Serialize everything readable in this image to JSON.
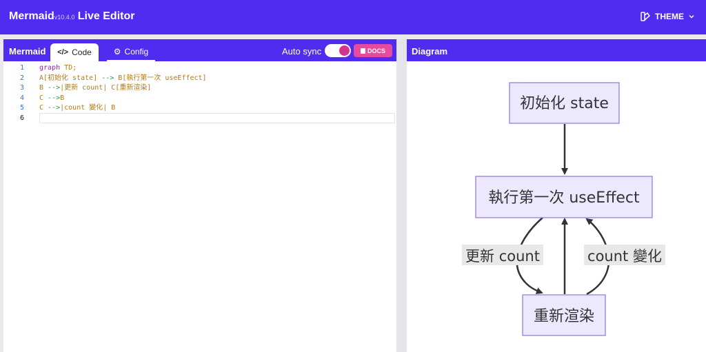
{
  "header": {
    "brand": "Mermaid",
    "version": "v10.4.0",
    "app": "Live Editor",
    "theme_label": "THEME"
  },
  "editor": {
    "title": "Mermaid",
    "tabs": [
      {
        "label": "Code",
        "icon": "code-icon"
      },
      {
        "label": "Config",
        "icon": "gears-icon"
      }
    ],
    "auto_sync_label": "Auto sync",
    "auto_sync_on": true,
    "docs_label": "DOCS",
    "lines": [
      {
        "n": "1",
        "parts": [
          {
            "t": "graph ",
            "c": "k"
          },
          {
            "t": "TD;",
            "c": "s"
          }
        ]
      },
      {
        "n": "2",
        "parts": [
          {
            "t": "A[初始化 state] ",
            "c": "s"
          },
          {
            "t": "-->",
            "c": "v"
          },
          {
            "t": " B[執行第一次 useEffect]",
            "c": "s"
          }
        ]
      },
      {
        "n": "3",
        "parts": [
          {
            "t": "B ",
            "c": "s"
          },
          {
            "t": "-->",
            "c": "v"
          },
          {
            "t": "|更新 count| C[重新渲染]",
            "c": "s"
          }
        ]
      },
      {
        "n": "4",
        "parts": [
          {
            "t": "C ",
            "c": "s"
          },
          {
            "t": "-->",
            "c": "v"
          },
          {
            "t": "B",
            "c": "s"
          }
        ]
      },
      {
        "n": "5",
        "parts": [
          {
            "t": "C ",
            "c": "s"
          },
          {
            "t": "-->",
            "c": "v"
          },
          {
            "t": "|count 變化| B",
            "c": "s"
          }
        ]
      },
      {
        "n": "6",
        "parts": []
      }
    ]
  },
  "diagram": {
    "title": "Diagram",
    "nodes": {
      "a": "初始化 state",
      "b": "執行第一次 useEffect",
      "c": "重新渲染"
    },
    "edge_labels": {
      "left": "更新 count",
      "right": "count 變化"
    },
    "colors": {
      "node_fill": "#ece9ff",
      "node_stroke": "#9370db",
      "edge": "#333333",
      "label_bg": "#e8e8e8"
    }
  }
}
